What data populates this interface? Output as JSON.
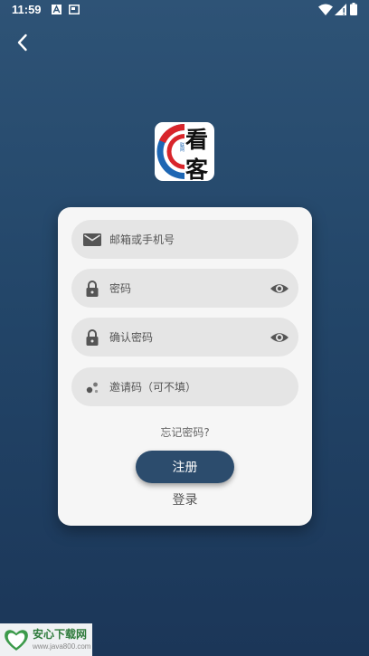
{
  "status_bar": {
    "time": "11:59"
  },
  "logo": {
    "char_top": "看",
    "char_bottom": "客",
    "small_text": "联网"
  },
  "form": {
    "email_placeholder": "邮箱或手机号",
    "password_placeholder": "密码",
    "confirm_placeholder": "确认密码",
    "invite_placeholder": "邀请码（可不填）",
    "forgot_label": "忘记密码?",
    "register_label": "注册",
    "login_label": "登录"
  },
  "watermark": {
    "text": "安心下载网",
    "url": "www.java800.com"
  },
  "colors": {
    "primary": "#2c4c6d",
    "background": "#234669",
    "field_bg": "#e5e5e5"
  }
}
